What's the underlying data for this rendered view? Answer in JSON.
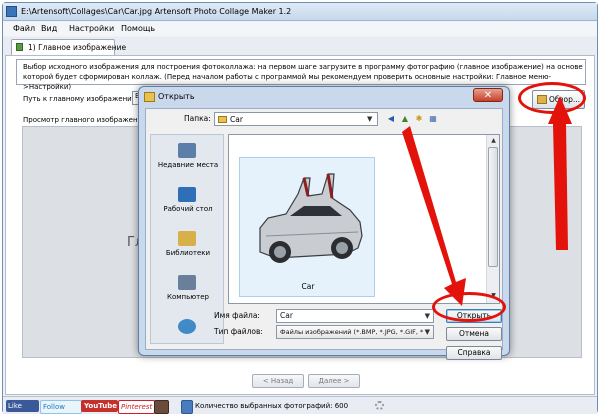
{
  "window": {
    "title": "E:\\Artensoft\\Collages\\Car\\Car.jpg Artensoft Photo Collage Maker 1.2"
  },
  "menu": {
    "items": [
      "Файл",
      "Вид",
      "Настройки",
      "Помощь"
    ]
  },
  "tabs": [
    {
      "label": "1) Главное изображение"
    }
  ],
  "main": {
    "info_text": "Выбор исходного изображения для построения фотоколлажа: на первом шаге загрузите в программу фотографию (главное изображение) на основе которой будет сформирован коллаж. (Перед началом работы с программой мы рекомендуем проверить основные настройки: Главное меню->Настройки)",
    "path_label": "Путь к главному изображению:",
    "path_value": "E",
    "preview_label": "Просмотр главного изображения:",
    "preview_text": "Гла",
    "browse_label": "Обзор...",
    "back_label": "< Назад",
    "next_label": "Далее >"
  },
  "statusbar": {
    "like": "Like",
    "follow": "Follow",
    "youtube": "YouTube",
    "pinterest": "Pinterest",
    "photo_count": "Количество выбранных фотографий: 600"
  },
  "dialog": {
    "title": "Открыть",
    "folder_label": "Папка:",
    "folder_value": "Car",
    "places": [
      {
        "label": "Недавние места",
        "icon": "recent-places-icon"
      },
      {
        "label": "Рабочий стол",
        "icon": "desktop-icon"
      },
      {
        "label": "Библиотеки",
        "icon": "libraries-icon"
      },
      {
        "label": "Компьютер",
        "icon": "computer-icon"
      },
      {
        "label": "",
        "icon": "network-icon"
      }
    ],
    "file_item": {
      "name": "Car"
    },
    "filename_label": "Имя файла:",
    "filename_value": "Car",
    "filetype_label": "Тип файлов:",
    "filetype_value": "Файлы изображений (*.BMP, *.JPG, *.GIF, *",
    "open_label": "Открыть",
    "cancel_label": "Отмена",
    "help_label": "Справка"
  },
  "colors": {
    "highlight": "#e3120b",
    "titlebar": "#c7d8ec",
    "dialog_frame": "#c9d8ea"
  }
}
